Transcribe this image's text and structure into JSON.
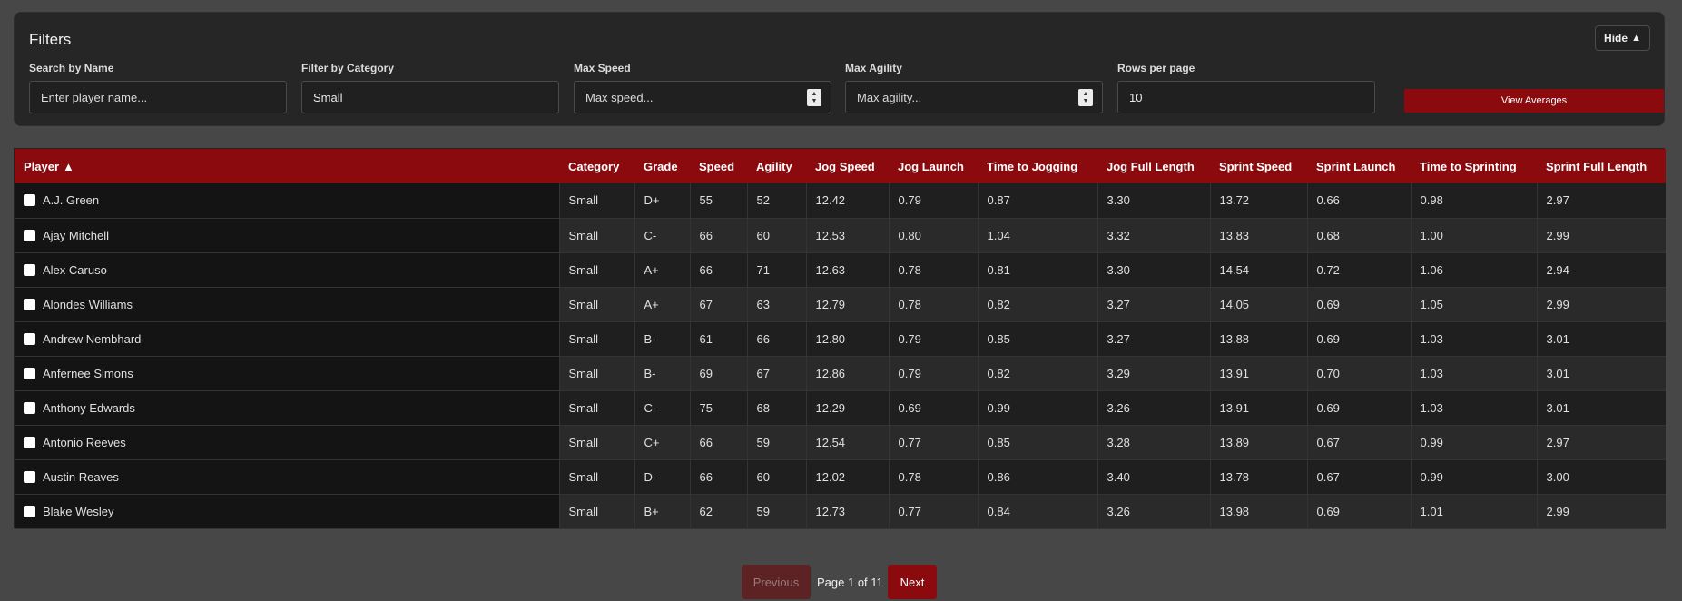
{
  "filters": {
    "title": "Filters",
    "hide_label": "Hide",
    "hide_arrow": "▲",
    "search": {
      "label": "Search by Name",
      "placeholder": "Enter player name...",
      "value": ""
    },
    "category": {
      "label": "Filter by Category",
      "value": "Small"
    },
    "max_speed": {
      "label": "Max Speed",
      "placeholder": "Max speed...",
      "value": ""
    },
    "max_agility": {
      "label": "Max Agility",
      "placeholder": "Max agility...",
      "value": ""
    },
    "rows_per_page": {
      "label": "Rows per page",
      "value": "10"
    },
    "averages_label": "View Averages"
  },
  "table": {
    "sort_arrow": "▲",
    "columns": [
      "Player",
      "Category",
      "Grade",
      "Speed",
      "Agility",
      "Jog Speed",
      "Jog Launch",
      "Time to Jogging",
      "Jog Full Length",
      "Sprint Speed",
      "Sprint Launch",
      "Time to Sprinting",
      "Sprint Full Length"
    ],
    "rows": [
      [
        "A.J. Green",
        "Small",
        "D+",
        "55",
        "52",
        "12.42",
        "0.79",
        "0.87",
        "3.30",
        "13.72",
        "0.66",
        "0.98",
        "2.97"
      ],
      [
        "Ajay Mitchell",
        "Small",
        "C-",
        "66",
        "60",
        "12.53",
        "0.80",
        "1.04",
        "3.32",
        "13.83",
        "0.68",
        "1.00",
        "2.99"
      ],
      [
        "Alex Caruso",
        "Small",
        "A+",
        "66",
        "71",
        "12.63",
        "0.78",
        "0.81",
        "3.30",
        "14.54",
        "0.72",
        "1.06",
        "2.94"
      ],
      [
        "Alondes Williams",
        "Small",
        "A+",
        "67",
        "63",
        "12.79",
        "0.78",
        "0.82",
        "3.27",
        "14.05",
        "0.69",
        "1.05",
        "2.99"
      ],
      [
        "Andrew Nembhard",
        "Small",
        "B-",
        "61",
        "66",
        "12.80",
        "0.79",
        "0.85",
        "3.27",
        "13.88",
        "0.69",
        "1.03",
        "3.01"
      ],
      [
        "Anfernee Simons",
        "Small",
        "B-",
        "69",
        "67",
        "12.86",
        "0.79",
        "0.82",
        "3.29",
        "13.91",
        "0.70",
        "1.03",
        "3.01"
      ],
      [
        "Anthony Edwards",
        "Small",
        "C-",
        "75",
        "68",
        "12.29",
        "0.69",
        "0.99",
        "3.26",
        "13.91",
        "0.69",
        "1.03",
        "3.01"
      ],
      [
        "Antonio Reeves",
        "Small",
        "C+",
        "66",
        "59",
        "12.54",
        "0.77",
        "0.85",
        "3.28",
        "13.89",
        "0.67",
        "0.99",
        "2.97"
      ],
      [
        "Austin Reaves",
        "Small",
        "D-",
        "66",
        "60",
        "12.02",
        "0.78",
        "0.86",
        "3.40",
        "13.78",
        "0.67",
        "0.99",
        "3.00"
      ],
      [
        "Blake Wesley",
        "Small",
        "B+",
        "62",
        "59",
        "12.73",
        "0.77",
        "0.84",
        "3.26",
        "13.98",
        "0.69",
        "1.01",
        "2.99"
      ]
    ]
  },
  "pagination": {
    "previous_label": "Previous",
    "page_info": "Page 1 of 11",
    "next_label": "Next"
  }
}
